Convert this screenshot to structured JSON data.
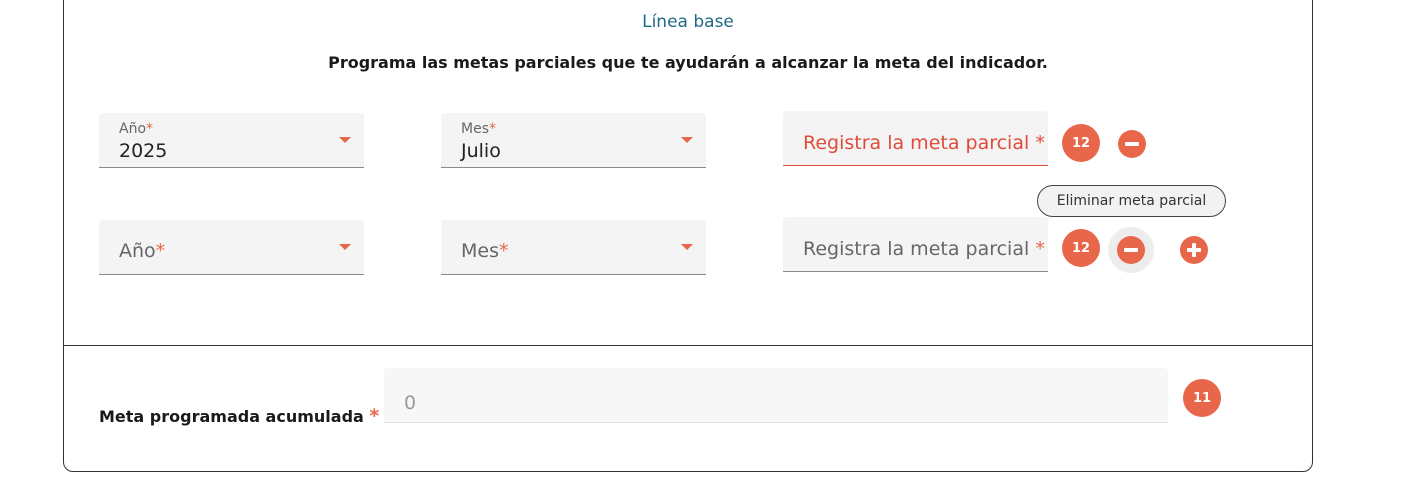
{
  "section": {
    "title": "Línea base",
    "subtitle": "Programa las metas parciales que te ayudarán a alcanzar la meta del indicador."
  },
  "rows": [
    {
      "year": {
        "label": "Año",
        "value": "2025"
      },
      "month": {
        "label": "Mes",
        "value": "Julio"
      },
      "goal": {
        "placeholder": "Registra la meta parcial",
        "value": "",
        "state": "error"
      },
      "badge": "12"
    },
    {
      "year": {
        "label": "Año",
        "value": ""
      },
      "month": {
        "label": "Mes",
        "value": ""
      },
      "goal": {
        "placeholder": "Registra la meta parcial",
        "value": "",
        "state": "default"
      },
      "badge": "12"
    }
  ],
  "required_mark": "*",
  "tooltip": "Eliminar meta parcial",
  "accumulated": {
    "label": "Meta programada acumulada",
    "value": "0",
    "badge": "11"
  },
  "icons": {
    "dropdown": "caret-down-icon",
    "remove": "minus-circle-icon",
    "add": "plus-circle-icon"
  },
  "colors": {
    "accent": "#e8664a",
    "error": "#e04b3a",
    "title": "#1f6a86"
  }
}
